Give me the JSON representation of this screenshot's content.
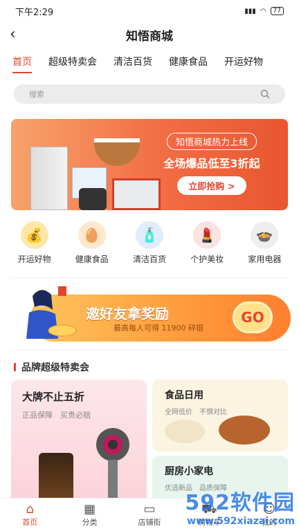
{
  "statusbar": {
    "time": "下午2:29",
    "battery": "77"
  },
  "navbar": {
    "back": "‹",
    "title": "知悟商城"
  },
  "tabs": [
    {
      "label": "首页",
      "active": true
    },
    {
      "label": "超级特卖会",
      "active": false
    },
    {
      "label": "清洁百货",
      "active": false
    },
    {
      "label": "健康食品",
      "active": false
    },
    {
      "label": "开运好物",
      "active": false
    }
  ],
  "search": {
    "placeholder": "搜索"
  },
  "banner": {
    "tag": "知悟商城热力上线",
    "headline": "全场爆品低至3折起",
    "button": "立即抢购 >"
  },
  "categories": [
    {
      "label": "开运好物",
      "icon": "lucky-icon",
      "color": "#ffe7a8"
    },
    {
      "label": "健康食品",
      "icon": "food-icon",
      "color": "#ffe8cc"
    },
    {
      "label": "清洁百货",
      "icon": "cleaner-icon",
      "color": "#dfeefc"
    },
    {
      "label": "个护美妆",
      "icon": "cosmetics-icon",
      "color": "#fde2e2"
    },
    {
      "label": "家用电器",
      "icon": "appliance-icon",
      "color": "#eeeeee"
    }
  ],
  "invite": {
    "title": "邀好友拿奖励",
    "subtitle": "最高每人可得 11900 碎银",
    "go": "GO"
  },
  "section": {
    "title": "品牌超级特卖会"
  },
  "cards": {
    "big": {
      "title": "大牌不止五折",
      "subtitle": "正品保障　买贵必赔"
    },
    "small1": {
      "title": "食品日用",
      "subtitle": "全网低价　不惧对比"
    },
    "small2": {
      "title": "厨房小家电",
      "subtitle": "优选新品　品质保障"
    }
  },
  "tabbar": [
    {
      "label": "首页",
      "icon": "home-icon",
      "active": true
    },
    {
      "label": "分类",
      "icon": "grid-icon",
      "active": false
    },
    {
      "label": "店铺街",
      "icon": "store-icon",
      "active": false
    },
    {
      "label": "购物车",
      "icon": "cart-icon",
      "active": false
    },
    {
      "label": "我的",
      "icon": "user-icon",
      "active": false
    }
  ],
  "watermark": {
    "brand": "592软件园",
    "url": "www.592xiazai.com"
  }
}
